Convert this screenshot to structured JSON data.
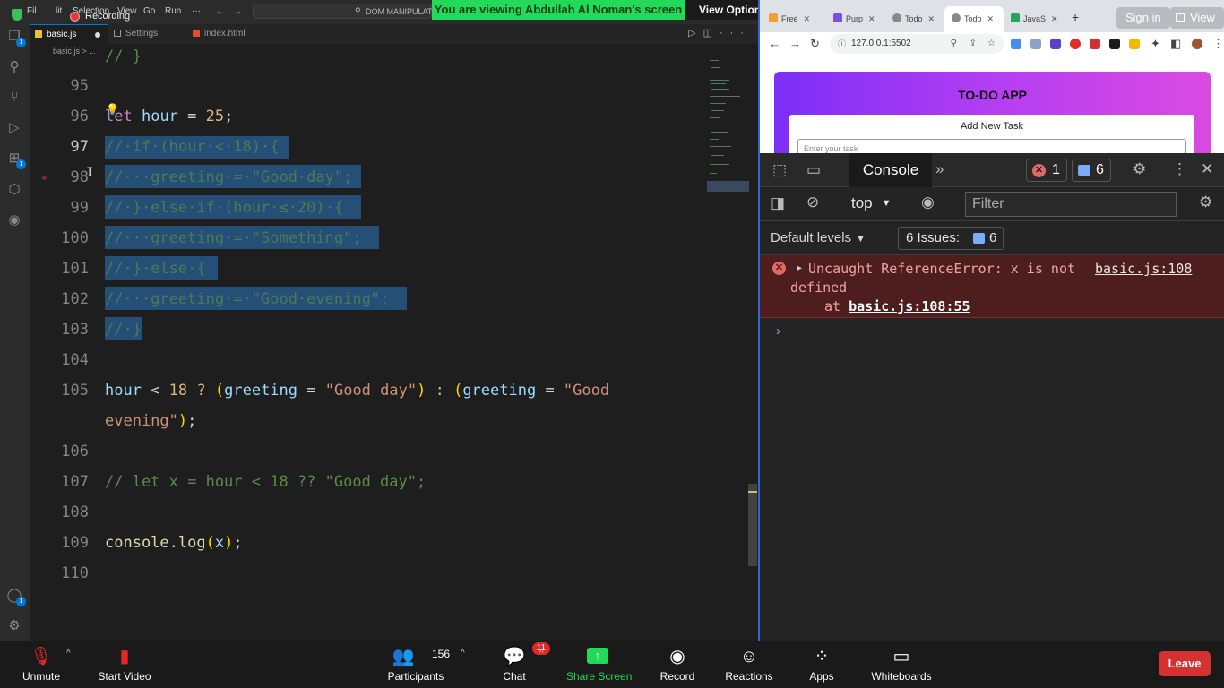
{
  "zoom": {
    "banner": "You are viewing Abdullah Al Noman's screen",
    "view_options": "View Options",
    "recording": "Recording",
    "bottom": {
      "unmute": "Unmute",
      "start_video": "Start Video",
      "participants": "Participants",
      "participants_count": "156",
      "chat": "Chat",
      "chat_badge": "11",
      "share_screen": "Share Screen",
      "record": "Record",
      "reactions": "Reactions",
      "apps": "Apps",
      "whiteboards": "Whiteboards",
      "leave": "Leave"
    },
    "sign_in": "Sign in",
    "view": "View"
  },
  "vscode": {
    "menu": [
      "File",
      "Edit",
      "Selection",
      "View",
      "Go",
      "Run",
      "···"
    ],
    "menu_visible": [
      "Fil",
      "lit",
      "Selection",
      "View",
      "Go",
      "Run",
      "···"
    ],
    "command_center": "DOM MANIPULATI",
    "tabs": [
      {
        "label": "basic.js",
        "active": true,
        "dirty": true
      },
      {
        "label": "Settings",
        "active": false
      },
      {
        "label": "index.html",
        "active": false
      }
    ],
    "breadcrumb": "basic.js > ...",
    "line_numbers": [
      "95",
      "96",
      "97",
      "98",
      "99",
      "100",
      "101",
      "102",
      "103",
      "104",
      "105",
      "",
      "106",
      "107",
      "108",
      "109",
      "110"
    ],
    "code": {
      "l94": "// }",
      "l96": [
        "let",
        " ",
        "hour",
        " = ",
        "25",
        ";"
      ],
      "l97": "//·if·(hour·<·18)·{",
      "l98": "//···greeting·=·\"Good·day\";",
      "l99": "//·}·else·if·(hour·≤·20)·{",
      "l100": "//···greeting·=·\"Something\";",
      "l101": "//·}·else·{",
      "l102": "//···greeting·=·\"Good·evening\";",
      "l103": "//·}",
      "l105a": [
        "hour",
        " < ",
        "18",
        " ? ",
        "(",
        "greeting",
        " = ",
        "\"Good day\"",
        ")",
        " : ",
        "(",
        "greeting",
        " = ",
        "\"Good"
      ],
      "l105b": [
        "evening\"",
        ")",
        ";"
      ],
      "l107": "// let x = hour < 18 ?? \"Good day\";",
      "l109": [
        "console",
        ".",
        "log",
        "(",
        "x",
        ")",
        ";"
      ]
    }
  },
  "chrome": {
    "tabs": [
      {
        "label": "Free",
        "color": "#f0a030"
      },
      {
        "label": "Purp",
        "color": "#7b4fe0"
      },
      {
        "label": "Todo",
        "color": "#888888"
      },
      {
        "label": "Todo",
        "color": "#888888",
        "active": true
      },
      {
        "label": "JavaS",
        "color": "#25a55f"
      }
    ],
    "url": "127.0.0.1:5502",
    "page": {
      "title": "TO-DO APP",
      "subtitle": "Add New Task",
      "input_placeholder": "Enter your task"
    },
    "devtools": {
      "tab": "Console",
      "errors": "1",
      "messages": "6",
      "context": "top",
      "filter_placeholder": "Filter",
      "levels": "Default levels",
      "issues_label": "6 Issues:",
      "issues_count": "6",
      "error_line1": "Uncaught ReferenceError: x is not",
      "error_link": "basic.js:108",
      "error_line2": "defined",
      "error_at": "at",
      "error_location": "basic.js:108:55"
    }
  },
  "colors": {
    "vscode_bg": "#1e1e1e",
    "selection": "#264f78",
    "zoom_green": "#23d959",
    "leave_red": "#d63131",
    "error_bg": "#4e1d1d",
    "todo_gradient_start": "#7b2ff7",
    "todo_gradient_end": "#d94be0"
  }
}
